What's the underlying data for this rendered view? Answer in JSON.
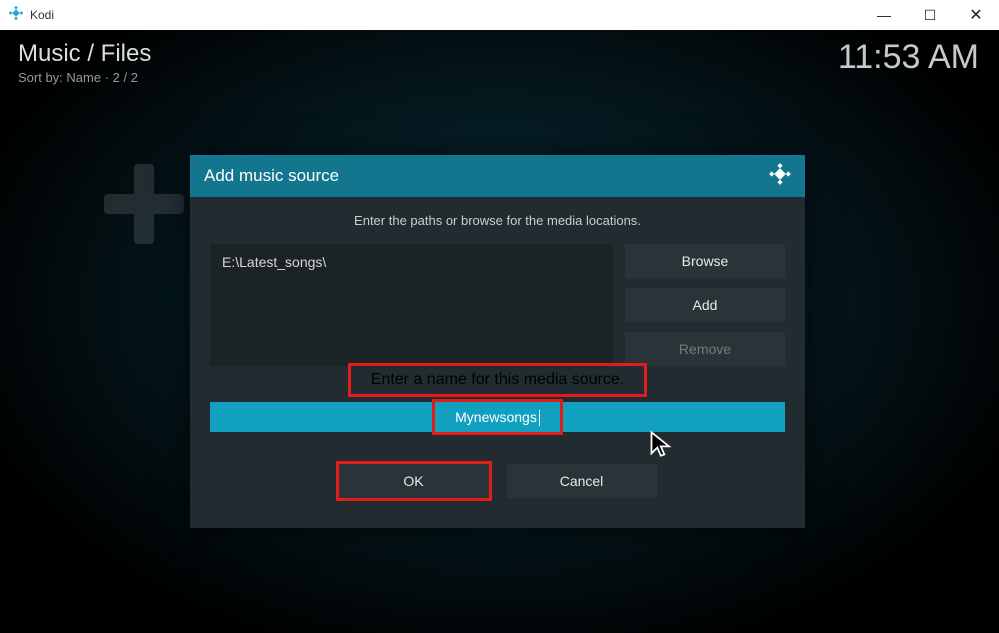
{
  "titlebar": {
    "app_name": "Kodi"
  },
  "breadcrumb": {
    "path": "Music / Files",
    "sort": "Sort by: Name  ·  2 / 2"
  },
  "clock": "11:53 AM",
  "dialog": {
    "title": "Add music source",
    "instruction": "Enter the paths or browse for the media locations.",
    "path_value": "E:\\Latest_songs\\",
    "btn_browse": "Browse",
    "btn_add": "Add",
    "btn_remove": "Remove",
    "name_label": "Enter a name for this media source.",
    "name_value": "Mynewsongs",
    "btn_ok": "OK",
    "btn_cancel": "Cancel"
  }
}
